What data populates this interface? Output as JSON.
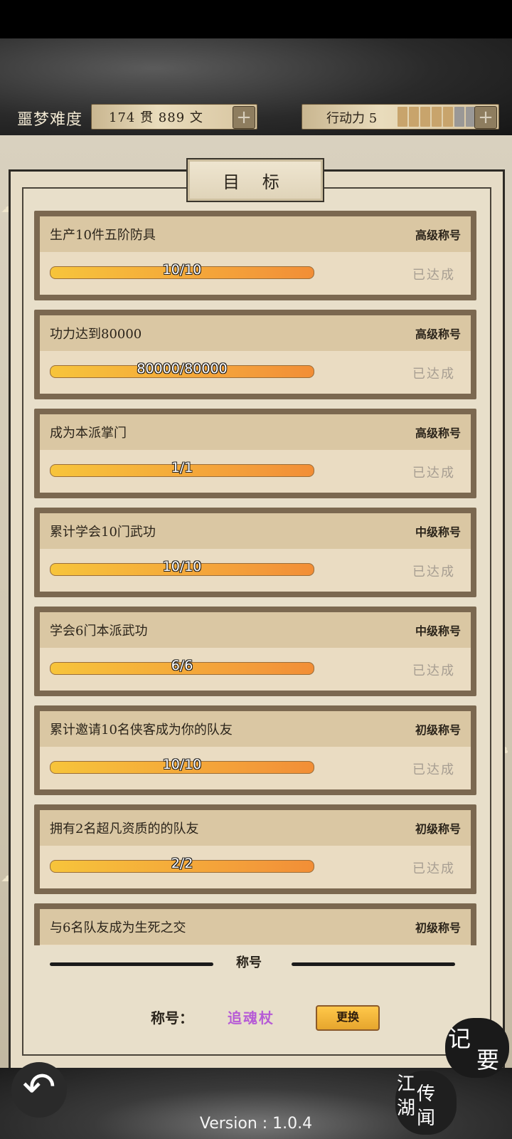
{
  "hud": {
    "difficulty": "噩梦难度",
    "money": "174 贯  889 文",
    "action_label": "行动力 5",
    "action_pips_filled": 5,
    "action_pips_total": 7
  },
  "panel": {
    "title": "目 标"
  },
  "goals": [
    {
      "title": "生产10件五阶防具",
      "rank": "高级称号",
      "progress": "10/10",
      "status": "已达成"
    },
    {
      "title": "功力达到80000",
      "rank": "高级称号",
      "progress": "80000/80000",
      "status": "已达成"
    },
    {
      "title": "成为本派掌门",
      "rank": "高级称号",
      "progress": "1/1",
      "status": "已达成"
    },
    {
      "title": "累计学会10门武功",
      "rank": "中级称号",
      "progress": "10/10",
      "status": "已达成"
    },
    {
      "title": "学会6门本派武功",
      "rank": "中级称号",
      "progress": "6/6",
      "status": "已达成"
    },
    {
      "title": "累计邀请10名侠客成为你的队友",
      "rank": "初级称号",
      "progress": "10/10",
      "status": "已达成"
    },
    {
      "title": "拥有2名超凡资质的的队友",
      "rank": "初级称号",
      "progress": "2/2",
      "status": "已达成"
    },
    {
      "title": "与6名队友成为生死之交",
      "rank": "初级称号",
      "progress": "",
      "status": ""
    }
  ],
  "title_section": {
    "header": "称号",
    "label": "称号：",
    "current_title": "追魂杖",
    "change_button": "更换"
  },
  "corner": {
    "jiyao_1": "记",
    "jiyao_2": "要",
    "jianghu_1": "江",
    "jianghu_2": "湖",
    "jianghu_3": "传",
    "jianghu_4": "闻"
  },
  "back_icon": "back-arrow-icon",
  "version": "Version : 1.0.4",
  "colors": {
    "title_value": "#b65bd6",
    "bar_start": "#f7c43b",
    "bar_end": "#f28e36",
    "button": "#ffc84a"
  }
}
